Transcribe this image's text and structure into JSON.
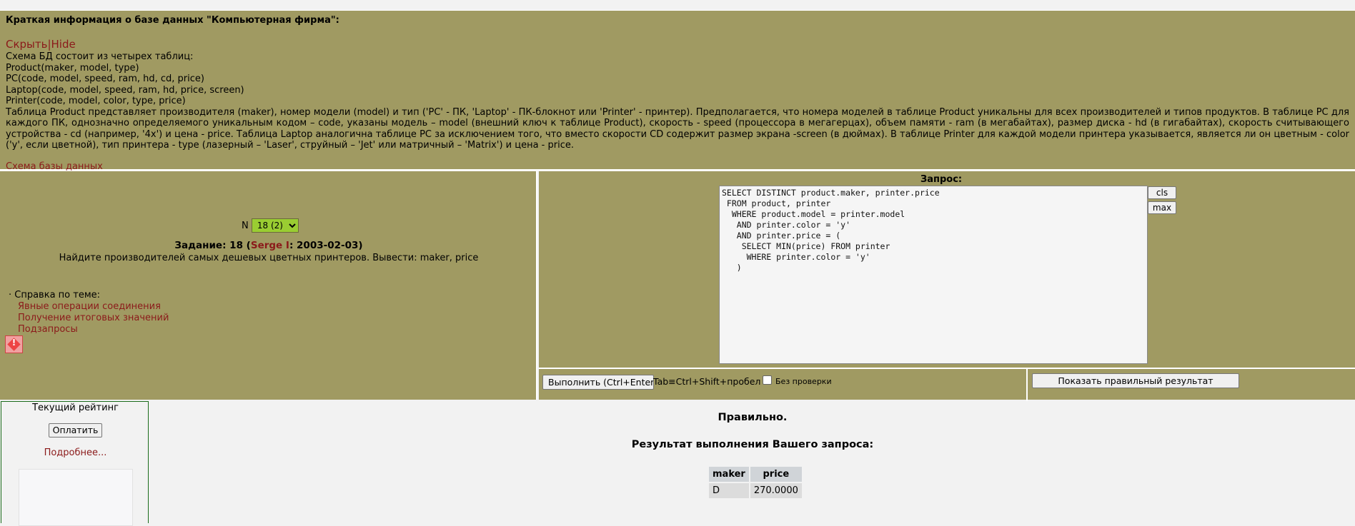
{
  "info": {
    "title": "Краткая информация о базе данных \"Компьютерная фирма\":",
    "toggle": "Скрыть|Hide",
    "lines": [
      "Схема БД состоит из четырех таблиц:",
      "Product(maker, model, type)",
      "PC(code, model, speed, ram, hd, cd, price)",
      "Laptop(code, model, speed, ram, hd, price, screen)",
      "Printer(code, model, color, type, price)"
    ],
    "description": "Таблица Product представляет производителя (maker), номер модели (model) и тип ('PC' - ПК, 'Laptop' - ПК-блокнот или 'Printer' - принтер). Предполагается, что номера моделей в таблице Product уникальны для всех производителей и типов продуктов. В таблице PC для каждого ПК, однозначно определяемого уникальным кодом – code, указаны модель – model (внешний ключ к таблице Product), скорость - speed (процессора в мегагерцах), объем памяти - ram (в мегабайтах), размер диска - hd (в гигабайтах), скорость считывающего устройства - cd (например, '4x') и цена - price. Таблица Laptop аналогична таблице РС за исключением того, что вместо скорости CD содержит размер экрана -screen (в дюймах). В таблице Printer для каждой модели принтера указывается, является ли он цветным - color ('y', если цветной), тип принтера - type (лазерный – 'Laser', струйный – 'Jet' или матричный – 'Matrix') и цена - price.",
    "schema_link": "Схема базы данных"
  },
  "task": {
    "n_label": "N",
    "n_selected": "18 (2)",
    "head_prefix": "Задание: 18 (",
    "author": "Serge I",
    "head_suffix": ": 2003-02-03)",
    "text": "Найдите производителей самых дешевых цветных принтеров. Вывести: maker, price"
  },
  "help": {
    "label": "· Справка по теме:",
    "links": [
      "Явные операции соединения",
      "Получение итоговых значений",
      "Подзапросы"
    ]
  },
  "query": {
    "label": "Запрос:",
    "sql": "SELECT DISTINCT product.maker, printer.price\n FROM product, printer\n  WHERE product.model = printer.model\n   AND printer.color = 'y'\n   AND printer.price = (\n    SELECT MIN(price) FROM printer\n     WHERE printer.color = 'y'\n   )",
    "cls_label": "cls",
    "max_label": "max"
  },
  "actions": {
    "execute_label": "Выполнить (Ctrl+Enter)",
    "tab_hint": "Tab≡Ctrl+Shift+пробел",
    "no_check_label": "Без проверки",
    "show_correct_label": "Показать правильный результат"
  },
  "rating": {
    "head": "Текущий рейтинг",
    "pay_label": "Оплатить",
    "more_label": "Подробнее..."
  },
  "result": {
    "status": "Правильно.",
    "title": "Результат выполнения Вашего запроса:",
    "columns": [
      "maker",
      "price"
    ],
    "rows": [
      [
        "D",
        "270.0000"
      ]
    ]
  },
  "colors": {
    "panel": "#a09a62",
    "link": "#8b1a1a",
    "select": "#9acd32"
  }
}
